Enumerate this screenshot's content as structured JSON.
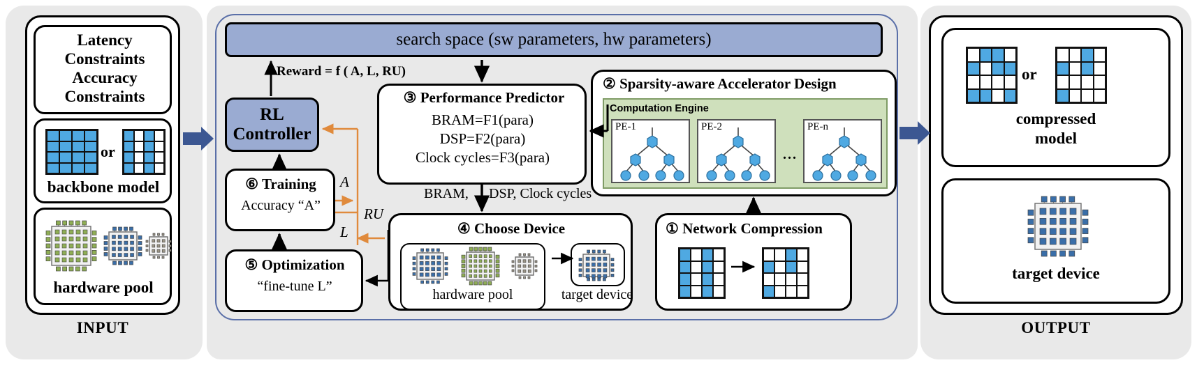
{
  "sections": {
    "input_label": "INPUT",
    "output_label": "OUTPUT"
  },
  "input": {
    "constraints": [
      "Latency",
      "Constraints",
      "Accuracy",
      "Constraints"
    ],
    "backbone": {
      "or_label": "or",
      "caption": "backbone model",
      "matrix_dense": [
        [
          1,
          1,
          1,
          1
        ],
        [
          1,
          1,
          1,
          1
        ],
        [
          1,
          1,
          1,
          1
        ],
        [
          1,
          1,
          1,
          1
        ]
      ],
      "matrix_sparse": [
        [
          1,
          0,
          1,
          0
        ],
        [
          1,
          0,
          1,
          0
        ],
        [
          1,
          0,
          1,
          0
        ],
        [
          1,
          0,
          1,
          0
        ]
      ]
    },
    "hardware_pool": {
      "caption": "hardware pool",
      "chips": [
        {
          "color": "#8fae55",
          "size": "large"
        },
        {
          "color": "#3a6ea8",
          "size": "medium"
        },
        {
          "color": "#9d9687",
          "size": "small"
        }
      ]
    }
  },
  "center": {
    "search_space": "search space (sw parameters, hw parameters)",
    "reward_label": "Reward = f ( A, L, RU)",
    "rl_controller": {
      "line1": "RL",
      "line2": "Controller"
    },
    "performance_predictor": {
      "number": "③",
      "title": "Performance  Predictor",
      "lines": [
        "BRAM=F1(para)",
        "DSP=F2(para)",
        "Clock cycles=F3(para)"
      ]
    },
    "predictor_out_label": "BRAM,        DSP, Clock cycles",
    "predictor_out_label_pre": "BRAM,",
    "predictor_out_label_post": "DSP, Clock cycles",
    "accelerator": {
      "number": "②",
      "title": "Sparsity-aware Accelerator Design",
      "engine_title": "Computation Engine",
      "pes": [
        "PE-1",
        "PE-2",
        "PE-n"
      ],
      "ellipsis": "..."
    },
    "network_compression": {
      "number": "①",
      "title": "Network Compression",
      "matrix_before": [
        [
          1,
          0,
          1,
          0
        ],
        [
          1,
          0,
          1,
          0
        ],
        [
          1,
          0,
          1,
          0
        ],
        [
          1,
          0,
          1,
          0
        ]
      ],
      "matrix_after": [
        [
          0,
          0,
          1,
          0
        ],
        [
          1,
          0,
          1,
          0
        ],
        [
          0,
          0,
          0,
          0
        ],
        [
          1,
          0,
          0,
          0
        ]
      ]
    },
    "choose_device": {
      "number": "④",
      "title": "Choose Device",
      "pool_caption": "hardware pool",
      "device_caption": "target device"
    },
    "optimization": {
      "number": "⑤",
      "title": "Optimization",
      "sub": "“fine-tune L”"
    },
    "training": {
      "number": "⑥",
      "title": "Training",
      "sub": "Accuracy “A”"
    },
    "edge_labels": {
      "a": "A",
      "l": "L",
      "ru": "RU"
    }
  },
  "output": {
    "compressed_model": {
      "or_label": "or",
      "caption_line1": "compressed",
      "caption_line2": "model",
      "matrix_left": [
        [
          0,
          1,
          1,
          0
        ],
        [
          1,
          0,
          1,
          1
        ],
        [
          0,
          0,
          0,
          0
        ],
        [
          1,
          1,
          0,
          1
        ]
      ],
      "matrix_right": [
        [
          0,
          0,
          1,
          0
        ],
        [
          1,
          0,
          1,
          0
        ],
        [
          0,
          0,
          0,
          0
        ],
        [
          1,
          0,
          0,
          0
        ]
      ]
    },
    "target_device": {
      "caption": "target device",
      "chip_color": "#3a6ea8"
    }
  },
  "colors": {
    "header_blue": "#9aabd2",
    "engine_green": "#cfe0bc",
    "matrix_blue": "#4fa9e2",
    "accent_orange": "#e08a3c",
    "block_arrow_blue": "#3c5792",
    "frame_grey": "#e9e9e9",
    "center_outline": "#5a6fa8"
  }
}
